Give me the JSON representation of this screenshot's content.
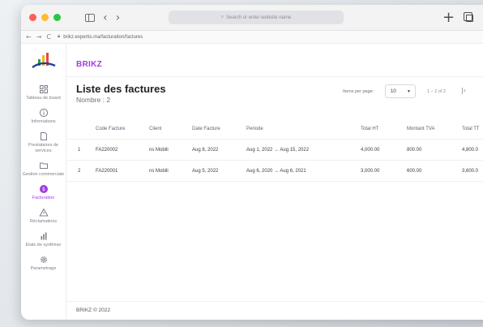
{
  "browser": {
    "search_placeholder": "Search or enter website name",
    "url": "brikz.expertis.ma/facturation/factures",
    "colors": {
      "close": "#ff5f57",
      "minimize": "#febc2e",
      "zoom": "#28c840"
    }
  },
  "app": {
    "brand": "BRIKZ",
    "accent": "#a23ce0",
    "footer": "BRIKZ © 2022"
  },
  "sidebar": {
    "items": [
      {
        "label": "Tableau de board",
        "icon": "dashboard-icon",
        "active": false
      },
      {
        "label": "Informations",
        "icon": "info-icon",
        "active": false
      },
      {
        "label": "Prestataires de services",
        "icon": "document-icon",
        "active": false
      },
      {
        "label": "Gestion commerciale",
        "icon": "folder-icon",
        "active": false
      },
      {
        "label": "Facturation",
        "icon": "invoice-coin-icon",
        "active": true
      },
      {
        "label": "Réclamations",
        "icon": "warning-icon",
        "active": false
      },
      {
        "label": "Etats de synthèse",
        "icon": "bar-chart-icon",
        "active": false
      },
      {
        "label": "Parametrage",
        "icon": "gear-icon",
        "active": false
      }
    ]
  },
  "page": {
    "title": "Liste des factures",
    "count": "Nombre : 2"
  },
  "pager": {
    "items_per_page_label": "Items per page:",
    "items_per_page_value": "10",
    "range": "1 – 2 of 2"
  },
  "table": {
    "headers": {
      "code": "Code Facture",
      "client": "Client",
      "date": "Date Facture",
      "period": "Periode",
      "total_ht": "Total HT",
      "tva": "Montant TVA",
      "ttc": "Total TT"
    },
    "rows": [
      {
        "num": "1",
        "code": "FA220002",
        "client": "ns Mobili",
        "date": "Aug 8, 2022",
        "period": "Aug 1, 2022 → Aug 15, 2022",
        "total_ht": "4,000.00",
        "tva": "800.00",
        "ttc": "4,800.0"
      },
      {
        "num": "2",
        "code": "FA220001",
        "client": "ns Mobili",
        "date": "Aug 5, 2022",
        "period": "Aug 6, 2020 → Aug 6, 2021",
        "total_ht": "3,000.00",
        "tva": "600.00",
        "ttc": "3,600.0"
      }
    ]
  }
}
